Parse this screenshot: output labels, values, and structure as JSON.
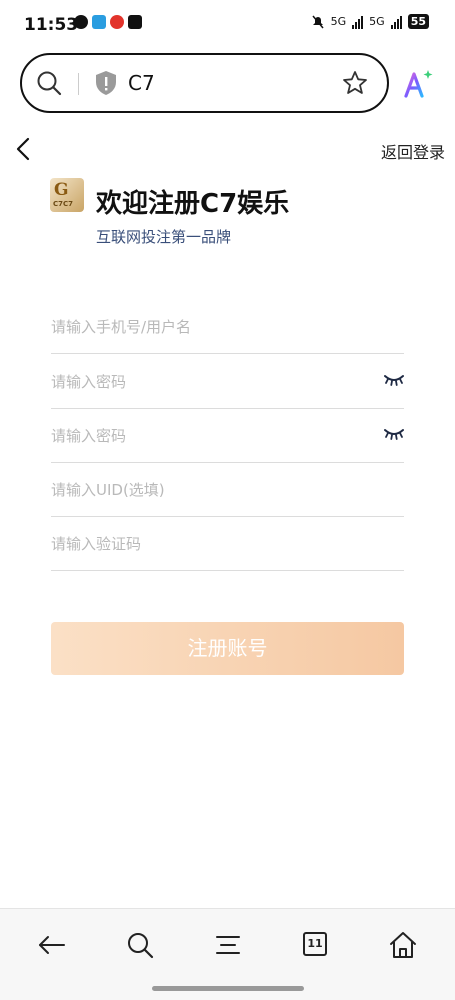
{
  "status_bar": {
    "time": "11:53",
    "network_1": "5G",
    "network_2": "5G",
    "battery": "55"
  },
  "browser": {
    "url": "C7"
  },
  "header": {
    "login_link": "返回登录"
  },
  "brand": {
    "title": "欢迎注册C7娱乐",
    "subtitle": "互联网投注第一品牌",
    "logo_text": "C7C7"
  },
  "form": {
    "username_placeholder": "请输入手机号/用户名",
    "password_placeholder": "请输入密码",
    "confirm_password_placeholder": "请输入密码",
    "uid_placeholder": "请输入UID(选填)",
    "code_placeholder": "请输入验证码",
    "register_label": "注册账号"
  },
  "bottom_nav": {
    "tab_count": "11"
  },
  "colors": {
    "button_start": "#fbe0c6",
    "button_end": "#f5c8a2",
    "subtitle": "#3a4f7a"
  }
}
